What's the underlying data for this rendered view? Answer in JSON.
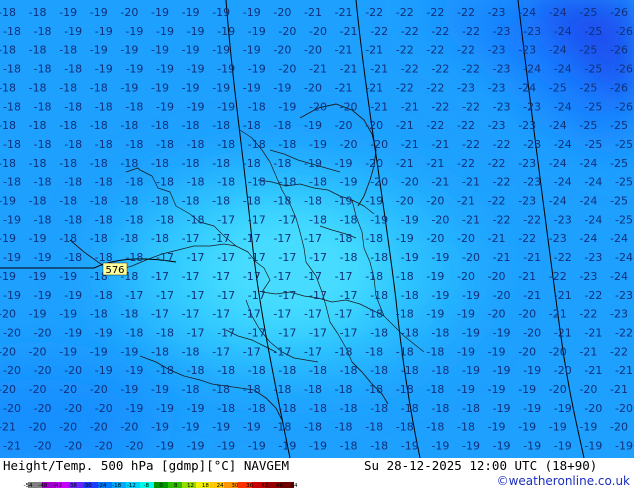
{
  "footer": {
    "title": "Height/Temp. 500 hPa [gdmp][°C] NAVGEM",
    "valid": "Su 28-12-2025 12:00 UTC (18+90)",
    "credit": "©weatheronline.co.uk"
  },
  "legend": {
    "labels": [
      "-54",
      "-48",
      "-42",
      "-38",
      "-30",
      "-24",
      "-18",
      "-12",
      "-8",
      "0",
      "8",
      "12",
      "18",
      "24",
      "30",
      "36",
      "42",
      "48",
      "54"
    ],
    "colors": [
      "#7f7f7f",
      "#a000c8",
      "#c800ff",
      "#6428ff",
      "#1e3cff",
      "#0078ff",
      "#00aaff",
      "#00d2ff",
      "#00ffe6",
      "#009600",
      "#32be00",
      "#96dc00",
      "#f0f000",
      "#ffc800",
      "#ff9600",
      "#ff3200",
      "#c80000",
      "#960000",
      "#6e0000"
    ]
  },
  "map": {
    "height_label": "576",
    "temperature_grid": [
      [
        "-18",
        "-18",
        "-19",
        "-19",
        "-20",
        "-19",
        "-19",
        "-19",
        "-19",
        "-20",
        "-21",
        "-21",
        "-22",
        "-22",
        "-22",
        "-22",
        "-23",
        "-24",
        "-24",
        "-25",
        "-26"
      ],
      [
        "-18",
        "-18",
        "-19",
        "-19",
        "-19",
        "-19",
        "-19",
        "-19",
        "-19",
        "-20",
        "-20",
        "-21",
        "-22",
        "-22",
        "-22",
        "-22",
        "-23",
        "-23",
        "-24",
        "-25",
        "-26"
      ],
      [
        "-18",
        "-18",
        "-18",
        "-19",
        "-19",
        "-19",
        "-19",
        "-19",
        "-19",
        "-20",
        "-20",
        "-21",
        "-21",
        "-22",
        "-22",
        "-22",
        "-23",
        "-23",
        "-24",
        "-25",
        "-26"
      ],
      [
        "-18",
        "-18",
        "-18",
        "-19",
        "-19",
        "-19",
        "-19",
        "-19",
        "-19",
        "-20",
        "-21",
        "-21",
        "-21",
        "-22",
        "-22",
        "-22",
        "-23",
        "-24",
        "-24",
        "-25",
        "-26"
      ],
      [
        "-18",
        "-18",
        "-18",
        "-18",
        "-19",
        "-19",
        "-19",
        "-19",
        "-19",
        "-19",
        "-20",
        "-21",
        "-21",
        "-22",
        "-22",
        "-23",
        "-23",
        "-24",
        "-25",
        "-25",
        "-26"
      ],
      [
        "-18",
        "-18",
        "-18",
        "-18",
        "-18",
        "-19",
        "-19",
        "-19",
        "-18",
        "-19",
        "-20",
        "-20",
        "-21",
        "-21",
        "-22",
        "-22",
        "-23",
        "-23",
        "-24",
        "-25",
        "-26"
      ],
      [
        "-18",
        "-18",
        "-18",
        "-18",
        "-18",
        "-18",
        "-18",
        "-18",
        "-18",
        "-18",
        "-19",
        "-20",
        "-20",
        "-21",
        "-22",
        "-22",
        "-23",
        "-23",
        "-24",
        "-25",
        "-25"
      ],
      [
        "-18",
        "-18",
        "-18",
        "-18",
        "-18",
        "-18",
        "-18",
        "-18",
        "-18",
        "-18",
        "-19",
        "-20",
        "-20",
        "-21",
        "-21",
        "-22",
        "-22",
        "-23",
        "-24",
        "-25",
        "-25"
      ],
      [
        "-18",
        "-18",
        "-18",
        "-18",
        "-18",
        "-18",
        "-18",
        "-18",
        "-18",
        "-18",
        "-19",
        "-19",
        "-20",
        "-21",
        "-21",
        "-22",
        "-22",
        "-23",
        "-24",
        "-24",
        "-25"
      ],
      [
        "-18",
        "-18",
        "-18",
        "-18",
        "-18",
        "-18",
        "-18",
        "-18",
        "-18",
        "-18",
        "-18",
        "-19",
        "-20",
        "-20",
        "-21",
        "-21",
        "-22",
        "-23",
        "-24",
        "-24",
        "-25"
      ],
      [
        "-19",
        "-18",
        "-18",
        "-18",
        "-18",
        "-18",
        "-18",
        "-18",
        "-18",
        "-18",
        "-18",
        "-19",
        "-19",
        "-20",
        "-20",
        "-21",
        "-22",
        "-23",
        "-24",
        "-24",
        "-25"
      ],
      [
        "-19",
        "-18",
        "-18",
        "-18",
        "-18",
        "-18",
        "-18",
        "-17",
        "-17",
        "-17",
        "-18",
        "-18",
        "-19",
        "-19",
        "-20",
        "-21",
        "-22",
        "-22",
        "-23",
        "-24",
        "-25"
      ],
      [
        "-19",
        "-19",
        "-18",
        "-18",
        "-18",
        "-18",
        "-17",
        "-17",
        "-17",
        "-17",
        "-17",
        "-18",
        "-18",
        "-19",
        "-20",
        "-20",
        "-21",
        "-22",
        "-23",
        "-24",
        "-24"
      ],
      [
        "-19",
        "-19",
        "-18",
        "-18",
        "-18",
        "-17",
        "-17",
        "-17",
        "-17",
        "-17",
        "-17",
        "-18",
        "-18",
        "-19",
        "-19",
        "-20",
        "-21",
        "-21",
        "-22",
        "-23",
        "-24"
      ],
      [
        "-19",
        "-19",
        "-19",
        "-18",
        "-18",
        "-17",
        "-17",
        "-17",
        "-17",
        "-17",
        "-17",
        "-17",
        "-18",
        "-18",
        "-19",
        "-20",
        "-20",
        "-21",
        "-22",
        "-23",
        "-24"
      ],
      [
        "-19",
        "-19",
        "-19",
        "-18",
        "-17",
        "-17",
        "-17",
        "-17",
        "-17",
        "-17",
        "-17",
        "-17",
        "-18",
        "-18",
        "-19",
        "-19",
        "-20",
        "-21",
        "-21",
        "-22",
        "-23"
      ],
      [
        "-20",
        "-19",
        "-19",
        "-18",
        "-18",
        "-17",
        "-17",
        "-17",
        "-17",
        "-17",
        "-17",
        "-17",
        "-18",
        "-18",
        "-19",
        "-19",
        "-20",
        "-20",
        "-21",
        "-22",
        "-23"
      ],
      [
        "-20",
        "-20",
        "-19",
        "-19",
        "-18",
        "-18",
        "-17",
        "-17",
        "-17",
        "-17",
        "-17",
        "-17",
        "-18",
        "-18",
        "-18",
        "-19",
        "-19",
        "-20",
        "-21",
        "-21",
        "-22"
      ],
      [
        "-20",
        "-20",
        "-19",
        "-19",
        "-19",
        "-18",
        "-18",
        "-17",
        "-17",
        "-17",
        "-17",
        "-18",
        "-18",
        "-18",
        "-18",
        "-19",
        "-19",
        "-20",
        "-20",
        "-21",
        "-22"
      ],
      [
        "-20",
        "-20",
        "-20",
        "-19",
        "-19",
        "-18",
        "-18",
        "-18",
        "-18",
        "-18",
        "-18",
        "-18",
        "-18",
        "-18",
        "-18",
        "-19",
        "-19",
        "-19",
        "-20",
        "-21",
        "-21"
      ],
      [
        "-20",
        "-20",
        "-20",
        "-20",
        "-19",
        "-19",
        "-18",
        "-18",
        "-18",
        "-18",
        "-18",
        "-18",
        "-18",
        "-18",
        "-18",
        "-19",
        "-19",
        "-19",
        "-20",
        "-20",
        "-21"
      ],
      [
        "-20",
        "-20",
        "-20",
        "-20",
        "-19",
        "-19",
        "-19",
        "-18",
        "-18",
        "-18",
        "-18",
        "-18",
        "-18",
        "-18",
        "-18",
        "-18",
        "-19",
        "-19",
        "-19",
        "-20",
        "-20"
      ],
      [
        "-21",
        "-20",
        "-20",
        "-20",
        "-20",
        "-19",
        "-19",
        "-19",
        "-19",
        "-18",
        "-18",
        "-18",
        "-18",
        "-18",
        "-18",
        "-18",
        "-19",
        "-19",
        "-19",
        "-19",
        "-20"
      ],
      [
        "-21",
        "-20",
        "-20",
        "-20",
        "-20",
        "-19",
        "-19",
        "-19",
        "-19",
        "-19",
        "-19",
        "-18",
        "-18",
        "-19",
        "-19",
        "-19",
        "-19",
        "-19",
        "-19",
        "-19",
        "-19"
      ]
    ]
  }
}
